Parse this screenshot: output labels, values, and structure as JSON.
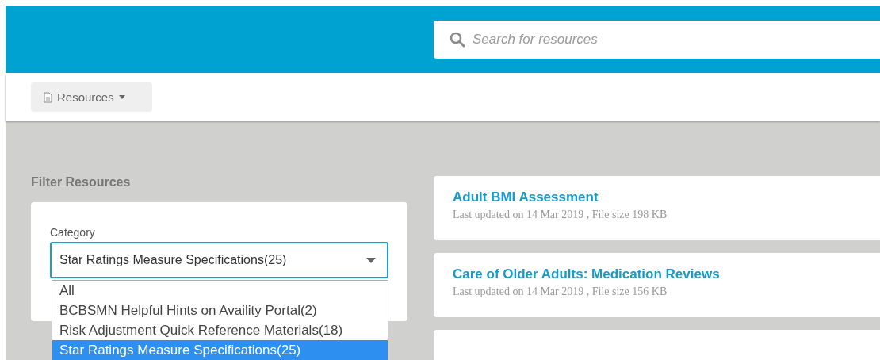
{
  "search": {
    "placeholder": "Search for resources"
  },
  "menu_button": {
    "label": "Resources"
  },
  "filter": {
    "heading": "Filter Resources",
    "category_label": "Category",
    "selected_value": "Star Ratings Measure Specifications(25)",
    "expanded": true,
    "options": [
      {
        "label": "All",
        "selected": false
      },
      {
        "label": "BCBSMN Helpful Hints on Availity Portal(2)",
        "selected": false
      },
      {
        "label": "Risk Adjustment Quick Reference Materials(18)",
        "selected": false
      },
      {
        "label": "Star Ratings Measure Specifications(25)",
        "selected": true
      }
    ]
  },
  "resources": [
    {
      "title": "Adult BMI Assessment",
      "meta": "Last updated on 14 Mar 2019 , File size 198 KB"
    },
    {
      "title": "Care of Older Adults: Medication Reviews",
      "meta": "Last updated on 14 Mar 2019 , File size 156 KB"
    }
  ]
}
